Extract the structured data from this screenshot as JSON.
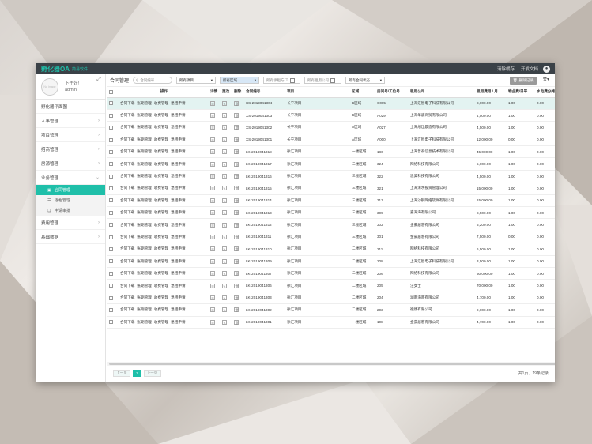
{
  "app": {
    "brand": "孵化器OA",
    "brand_sub": "简易软件",
    "clear_cache": "清除缓存",
    "dev_docs": "开发文档"
  },
  "profile": {
    "avatar_text": "No Image",
    "greeting": "下午好!",
    "username": "admin"
  },
  "sidebar": {
    "items": [
      {
        "label": "孵化器平面图"
      },
      {
        "label": "人事管理"
      },
      {
        "label": "项目管理"
      },
      {
        "label": "招商管理"
      },
      {
        "label": "房源管理"
      },
      {
        "label": "业务管理"
      }
    ],
    "subitems": [
      {
        "label": "合同管理"
      },
      {
        "label": "退租管理"
      },
      {
        "label": "申请审批"
      }
    ],
    "items_after": [
      {
        "label": "费用管理"
      },
      {
        "label": "基础数据"
      }
    ]
  },
  "toolbar": {
    "title": "合同管理",
    "search_placeholder": "合同编号",
    "project_select": "所有项目",
    "area_select": "所有区域",
    "lessee_placeholder": "所有承租方/工",
    "company_placeholder": "所有租用公司",
    "status_select": "所有合同状态",
    "delete_label": "删除记录"
  },
  "table": {
    "headers": [
      "操作",
      "详情",
      "更改",
      "删除",
      "合同编号",
      "项目",
      "区域",
      "房间号/工位号",
      "租用公司",
      "租用费用 / 月",
      "物业费/日平",
      "水电费分摊比"
    ],
    "op_labels": [
      "合同下载",
      "账期管理",
      "收费管理",
      "退租申请"
    ],
    "rows": [
      [
        "XS-2019041304",
        "长宁项目",
        "B区域",
        "C005",
        "上海汇智电子科技有限公司",
        "8,000.00",
        "1.00",
        "0.00"
      ],
      [
        "XS-2019041303",
        "长宁项目",
        "B区域",
        "A029",
        "上海华骏商贸有限公司",
        "4,500.00",
        "1.00",
        "0.00"
      ],
      [
        "XS-2019041302",
        "长宁项目",
        "A区域",
        "A027",
        "上海旭辽晨造有限公司",
        "4,500.00",
        "1.00",
        "0.00"
      ],
      [
        "XS-2019041301",
        "长宁项目",
        "A区域",
        "A000",
        "上海汇智电子科技有限公司",
        "12,000.00",
        "0.00",
        "0.00"
      ],
      [
        "LK-2019041318",
        "徐汇项目",
        "一楼区域",
        "186",
        "上海普泰信息技术有限公司",
        "45,000.00",
        "1.00",
        "0.00"
      ],
      [
        "LK-2019041317",
        "徐汇项目",
        "三楼区域",
        "324",
        "网络科技有限公司",
        "5,000.00",
        "1.00",
        "0.00"
      ],
      [
        "LK-2019041316",
        "徐汇项目",
        "三楼区域",
        "322",
        "思美科技有限公司",
        "4,500.00",
        "1.00",
        "0.00"
      ],
      [
        "LK-2019041315",
        "徐汇项目",
        "三楼区域",
        "321",
        "上海清水投资管理公司",
        "15,000.00",
        "1.00",
        "0.00"
      ],
      [
        "LK-2019041314",
        "徐汇项目",
        "三楼区域",
        "317",
        "上海沙钢网络软件有限公司",
        "15,000.00",
        "1.00",
        "0.00"
      ],
      [
        "LK-2019041313",
        "徐汇项目",
        "三楼区域",
        "309",
        "嘉海海有限公司",
        "8,500.00",
        "1.00",
        "0.00"
      ],
      [
        "LK-2019041312",
        "徐汇项目",
        "三楼区域",
        "302",
        "金豪居客有限公司",
        "5,200.00",
        "1.00",
        "0.00"
      ],
      [
        "LK-2019041311",
        "徐汇项目",
        "三楼区域",
        "301",
        "金豪居客有限公司",
        "7,500.00",
        "0.00",
        "0.00"
      ],
      [
        "LK-2019041310",
        "徐汇项目",
        "二楼区域",
        "211",
        "网络科技有限公司",
        "6,500.00",
        "1.00",
        "0.00"
      ],
      [
        "LK-2019041309",
        "徐汇项目",
        "二楼区域",
        "208",
        "上海汇智电子科技有限公司",
        "3,500.00",
        "1.00",
        "0.00"
      ],
      [
        "LK-2019041307",
        "徐汇项目",
        "二楼区域",
        "206",
        "网络科技有限公司",
        "50,000.00",
        "1.00",
        "0.00"
      ],
      [
        "LK-2019041306",
        "徐汇项目",
        "二楼区域",
        "205",
        "汪女士",
        "70,000.00",
        "1.00",
        "0.00"
      ],
      [
        "LK-2019041303",
        "徐汇项目",
        "二楼区域",
        "204",
        "湖南海南有限公司",
        "4,700.00",
        "1.00",
        "0.00"
      ],
      [
        "LK-2019041302",
        "徐汇项目",
        "二楼区域",
        "203",
        "德康有限公司",
        "9,000.00",
        "1.00",
        "0.00"
      ],
      [
        "LK-2019041301",
        "徐汇项目",
        "一楼区域",
        "108",
        "金豪居客有限公司",
        "4,700.00",
        "1.00",
        "0.00"
      ]
    ]
  },
  "pager": {
    "prev": "上一页",
    "current": "1",
    "next": "下一页",
    "info": "共1页、19条记录"
  },
  "colors": {
    "accent": "#1fbfa9",
    "topbar": "#3a4147"
  }
}
